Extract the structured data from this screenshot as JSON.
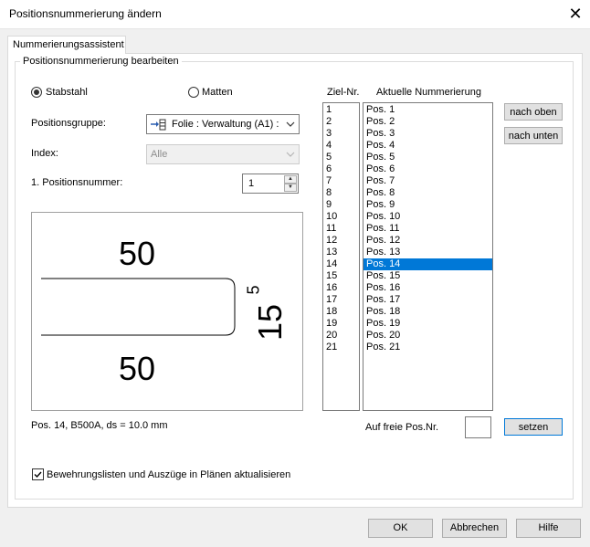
{
  "window": {
    "title": "Positionsnummerierung ändern",
    "close_glyph": "✕"
  },
  "tab": {
    "label": "Nummerierungsassistent"
  },
  "group": {
    "label": "Positionsnummerierung bearbeiten"
  },
  "radios": {
    "stabstahl": {
      "label": "Stabstahl",
      "checked": true
    },
    "matten": {
      "label": "Matten",
      "checked": false
    }
  },
  "fields": {
    "positionsgruppe": {
      "label": "Positionsgruppe:",
      "value": "Folie : Verwaltung (A1) :",
      "icon": "layer-icon"
    },
    "index": {
      "label": "Index:",
      "value": "Alle"
    },
    "positionsnummer": {
      "label": "1. Positionsnummer:",
      "value": "1"
    }
  },
  "preview": {
    "top_value": "50",
    "bottom_value": "50",
    "side_value": "15",
    "side_superscript": "5"
  },
  "info": {
    "text": "Pos. 14, B500A, ds = 10.0 mm"
  },
  "lists": {
    "ziel_header": "Ziel-Nr.",
    "aktuell_header": "Aktuelle Nummerierung",
    "ziel": [
      "1",
      "2",
      "3",
      "4",
      "5",
      "6",
      "7",
      "8",
      "9",
      "10",
      "11",
      "12",
      "13",
      "14",
      "15",
      "16",
      "17",
      "18",
      "19",
      "20",
      "21"
    ],
    "aktuell": [
      "Pos. 1",
      "Pos. 2",
      "Pos. 3",
      "Pos. 4",
      "Pos. 5",
      "Pos. 6",
      "Pos. 7",
      "Pos. 8",
      "Pos. 9",
      "Pos. 10",
      "Pos. 11",
      "Pos. 12",
      "Pos. 13",
      "Pos. 14",
      "Pos. 15",
      "Pos. 16",
      "Pos. 17",
      "Pos. 18",
      "Pos. 19",
      "Pos. 20",
      "Pos. 21"
    ],
    "selected_index": 13
  },
  "side_buttons": {
    "up": "nach oben",
    "down": "nach unten"
  },
  "freie": {
    "label": "Auf freie Pos.Nr.",
    "value": "",
    "set_button": "setzen"
  },
  "checkbox": {
    "label": "Bewehrungslisten und Auszüge in Plänen aktualisieren",
    "checked": true
  },
  "footer": {
    "ok": "OK",
    "cancel": "Abbrechen",
    "help": "Hilfe"
  },
  "colors": {
    "selection": "#0078d7",
    "default_button_border": "#0078d7"
  }
}
